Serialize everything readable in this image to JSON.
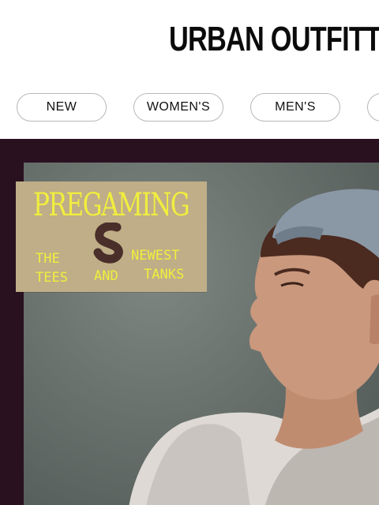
{
  "header": {
    "brand": "URBAN OUTFITTERS"
  },
  "nav": {
    "items": [
      {
        "label": "NEW"
      },
      {
        "label": "WOMEN'S"
      },
      {
        "label": "MEN'S"
      },
      {
        "label": ""
      }
    ]
  },
  "hero": {
    "title": "PREGAMING",
    "words": [
      "THE",
      "TEES",
      "AND",
      "NEWEST",
      "TANKS"
    ],
    "colors": {
      "frame": "#2a1120",
      "sticker": "#bfae87",
      "sticker_text": "#f1ee3e"
    }
  }
}
